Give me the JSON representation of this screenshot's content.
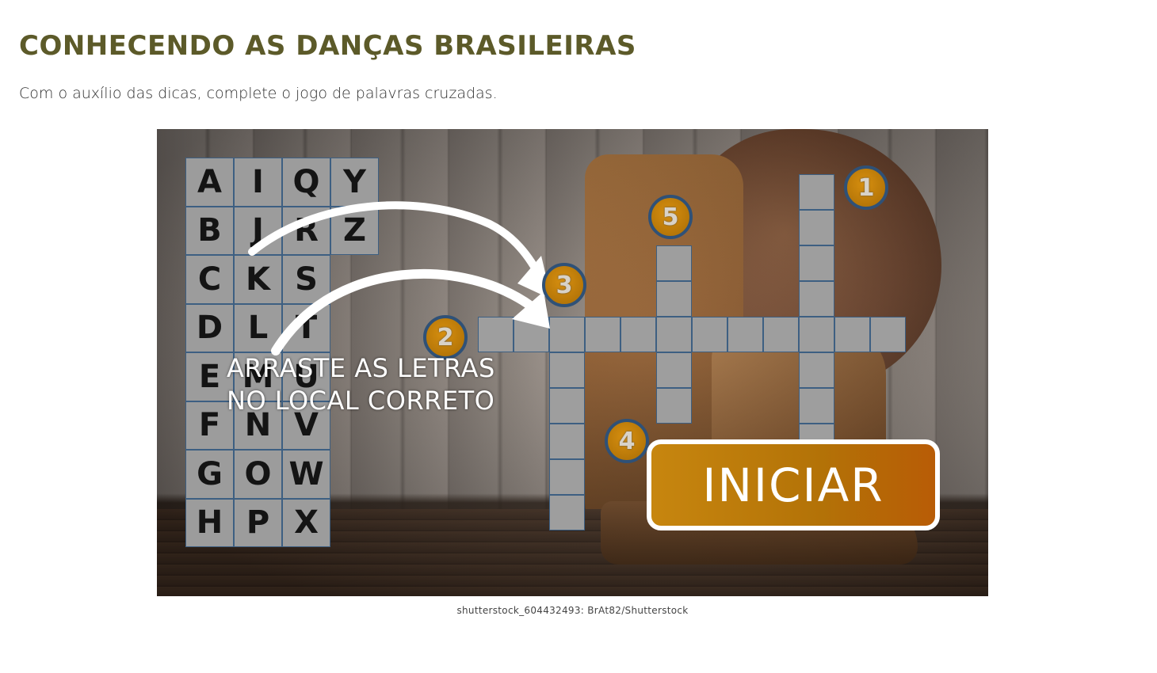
{
  "header": {
    "title": "CONHECENDO AS DANÇAS BRASILEIRAS",
    "instructions": "Com o auxílio das dicas, complete o jogo de palavras cruzadas."
  },
  "game": {
    "letters": [
      "A",
      "I",
      "Q",
      "Y",
      "B",
      "J",
      "R",
      "Z",
      "C",
      "K",
      "S",
      "",
      "D",
      "L",
      "T",
      "",
      "E",
      "M",
      "U",
      "",
      "F",
      "N",
      "V",
      "",
      "G",
      "O",
      "W",
      "",
      "H",
      "P",
      "X",
      ""
    ],
    "drag_hint": "ARRASTE AS LETRAS\nNO LOCAL CORRETO",
    "clues": [
      "1",
      "2",
      "3",
      "4",
      "5"
    ],
    "start_label": "INICIAR"
  },
  "caption": "shutterstock_604432493: BrAt82/Shutterstock",
  "colors": {
    "title": "#5c5a29",
    "tile": "#9c9c9c",
    "tile_border": "#3d5f82",
    "badge": "#c07f0a",
    "button": "#b87408"
  }
}
